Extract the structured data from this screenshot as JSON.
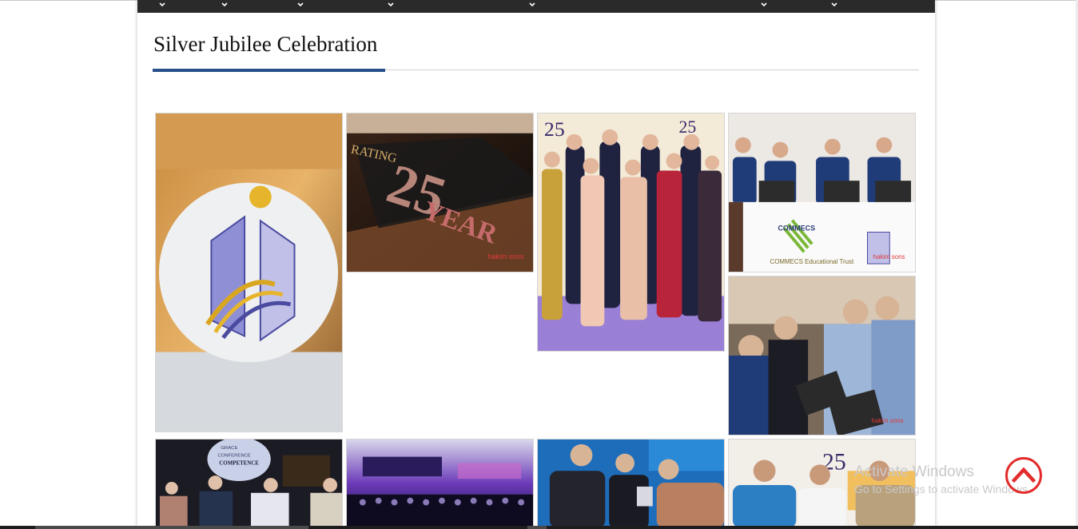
{
  "page": {
    "title": "Silver Jubilee Celebration",
    "accent_color": "#264f8c",
    "nav_dropdowns": [
      "chevron-down-icon",
      "chevron-down-icon",
      "chevron-down-icon",
      "chevron-down-icon",
      "chevron-down-icon",
      "chevron-down-icon",
      "chevron-down-icon"
    ]
  },
  "gallery": {
    "items": [
      {
        "label": "COMMECS",
        "subject": "COMMECS logo sign"
      },
      {
        "label": "25 YEAR",
        "subject": "Celebrating 25 years banner",
        "caption_top": "RATING",
        "credit": "hakim sons"
      },
      {
        "label": "25",
        "subject": "Group photo of students"
      },
      {
        "label": "COMMECS Educational Trust",
        "subject": "Students at laptop desk",
        "credit": "hakim sons"
      },
      {
        "label": "",
        "subject": "Visitors at laptop stall",
        "credit": "hakim sons"
      },
      {
        "label": "COMPETENCE",
        "subject": "Conference panel",
        "caption_top": "GRACE CONFERENCE"
      },
      {
        "label": "",
        "subject": "Auditorium audience"
      },
      {
        "label": "",
        "subject": "Award presentation"
      },
      {
        "label": "25",
        "subject": "Guests on stage"
      }
    ]
  },
  "watermark": {
    "line1": "Activate Windows",
    "line2": "Go to Settings to activate Windows."
  },
  "scroll_top": {
    "icon": "chevron-up-circle-icon",
    "color": "#e32b2b"
  }
}
